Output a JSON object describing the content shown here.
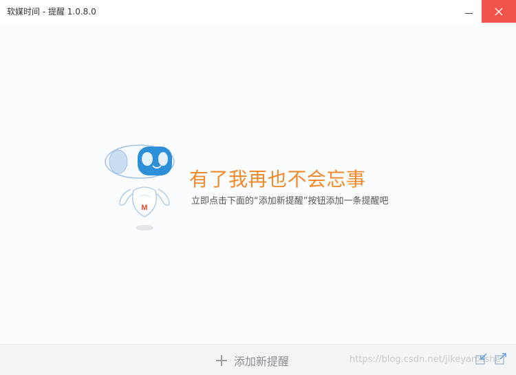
{
  "window": {
    "title": "软媒时间 - 提醒 1.0.8.0"
  },
  "empty_state": {
    "headline": "有了我再也不会忘事",
    "hint": "立即点击下面的“添加新提醒”按钮添加一条提醒吧"
  },
  "footer": {
    "add_label": "添加新提醒",
    "watermark": "https://blog.csdn.net/jikeyanxishe"
  },
  "icons": {
    "minimize": "minimize-icon",
    "close": "close-icon",
    "add": "plus-icon",
    "shrink": "shrink-window-icon",
    "expand": "expand-window-icon",
    "mascot": "robot-mascot-icon"
  },
  "colors": {
    "accent": "#f08a2c",
    "close_button": "#f0544a",
    "mascot_blue": "#2d8fd8"
  }
}
